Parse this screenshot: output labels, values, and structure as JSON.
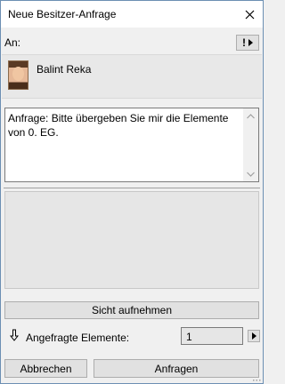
{
  "window": {
    "title": "Neue Besitzer-Anfrage",
    "close_icon": "close-icon"
  },
  "to": {
    "label": "An:",
    "button_glyph": "!"
  },
  "recipient": {
    "name": "Balint Reka",
    "avatar_icon": "user-photo"
  },
  "message": {
    "text": "Anfrage: Bitte übergeben Sie mir die Elemente von 0. EG."
  },
  "actions": {
    "view_button": "Sicht aufnehmen",
    "count_label": "Angefragte Elemente:",
    "count_value": "1",
    "cancel_button": "Abbrechen",
    "request_button": "Anfragen"
  },
  "colors": {
    "window_bg": "#f0f0f0",
    "titlebar_bg": "#ffffff",
    "border": "#6c8fb3"
  }
}
